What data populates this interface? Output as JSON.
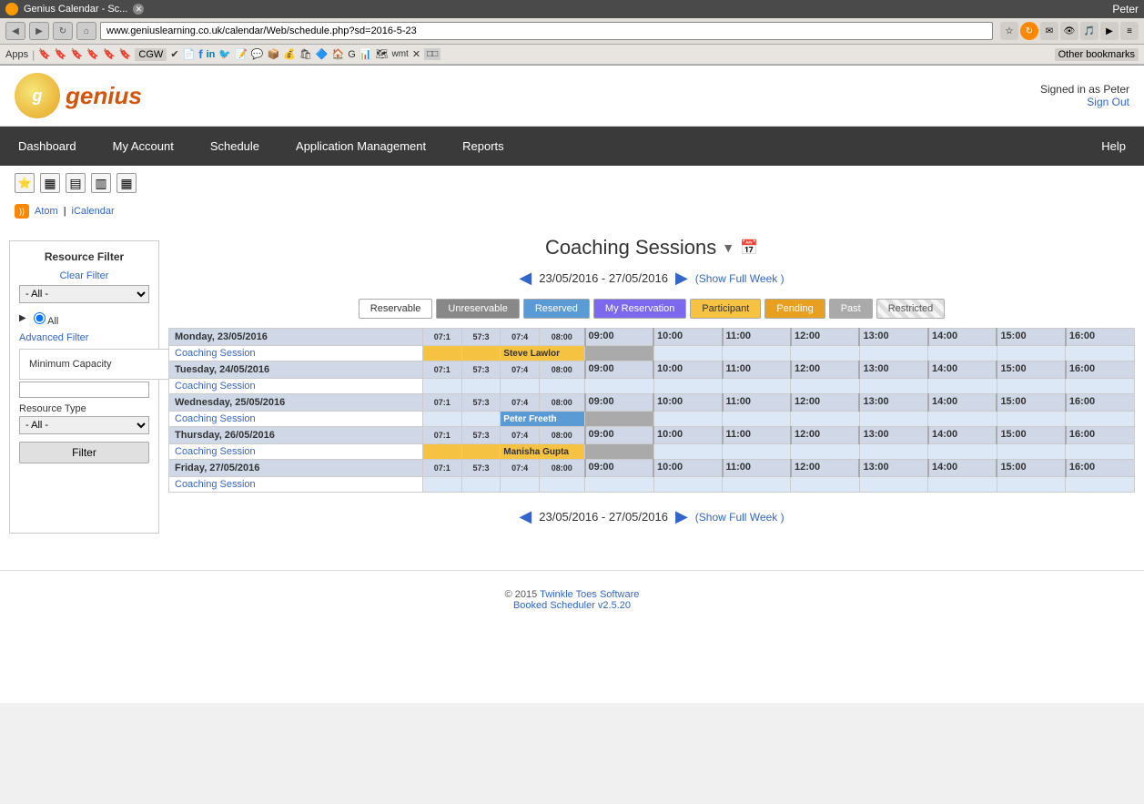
{
  "browser": {
    "tab_title": "Genius Calendar - Sc...",
    "url": "www.geniuslearning.co.uk/calendar/Web/schedule.php?sd=2016-5-23",
    "user": "Peter"
  },
  "header": {
    "logo": "genius",
    "signed_in_as": "Signed in as Peter",
    "sign_out": "Sign Out"
  },
  "nav": {
    "items": [
      "Dashboard",
      "My Account",
      "Schedule",
      "Application Management",
      "Reports"
    ],
    "help": "Help"
  },
  "bookmarks": {
    "items": [
      "Apps",
      "CGW",
      "Other bookmarks"
    ]
  },
  "calendar": {
    "title": "Coaching Sessions",
    "date_range": "23/05/2016 - 27/05/2016",
    "show_full_week": "(Show Full Week )",
    "legend": [
      {
        "label": "Reservable",
        "type": "reservable"
      },
      {
        "label": "Unreservable",
        "type": "unreservable"
      },
      {
        "label": "Reserved",
        "type": "reserved"
      },
      {
        "label": "My Reservation",
        "type": "my-reservation"
      },
      {
        "label": "Participant",
        "type": "participant"
      },
      {
        "label": "Pending",
        "type": "pending"
      },
      {
        "label": "Past",
        "type": "past"
      },
      {
        "label": "Restricted",
        "type": "restricted"
      }
    ],
    "days": [
      {
        "label": "Monday, 23/05/2016",
        "sessions": [
          {
            "name": "Coaching Session",
            "participant_name": "Steve Lawlor",
            "type": "participant"
          }
        ]
      },
      {
        "label": "Tuesday, 24/05/2016",
        "sessions": [
          {
            "name": "Coaching Session",
            "participant_name": "",
            "type": "reservable"
          }
        ]
      },
      {
        "label": "Wednesday, 25/05/2016",
        "sessions": [
          {
            "name": "Coaching Session",
            "participant_name": "Peter Freeth",
            "type": "reserved"
          }
        ]
      },
      {
        "label": "Thursday, 26/05/2016",
        "sessions": [
          {
            "name": "Coaching Session",
            "participant_name": "Manisha Gupta",
            "type": "participant"
          }
        ]
      },
      {
        "label": "Friday, 27/05/2016",
        "sessions": [
          {
            "name": "Coaching Session",
            "participant_name": "",
            "type": "reservable"
          }
        ]
      }
    ],
    "time_labels": [
      "07:1",
      "57:3",
      "07:4",
      "08:00",
      "09:00",
      "10:00",
      "11:00",
      "12:00",
      "13:00",
      "14:00",
      "15:00",
      "16:00"
    ]
  },
  "sidebar": {
    "title": "Resource Filter",
    "clear_filter": "Clear Filter",
    "all_label": "- All -",
    "all_radio": "All",
    "advanced_filter": "Advanced Filter",
    "min_capacity_label": "Minimum Capacity",
    "resource_type_label": "Resource Type",
    "filter_button": "Filter"
  },
  "feeds": {
    "atom": "Atom",
    "icalendar": "iCalendar"
  },
  "footer": {
    "copyright": "© 2015 Twinkle Toes Software",
    "booked": "Booked Scheduler v2.5.20"
  }
}
